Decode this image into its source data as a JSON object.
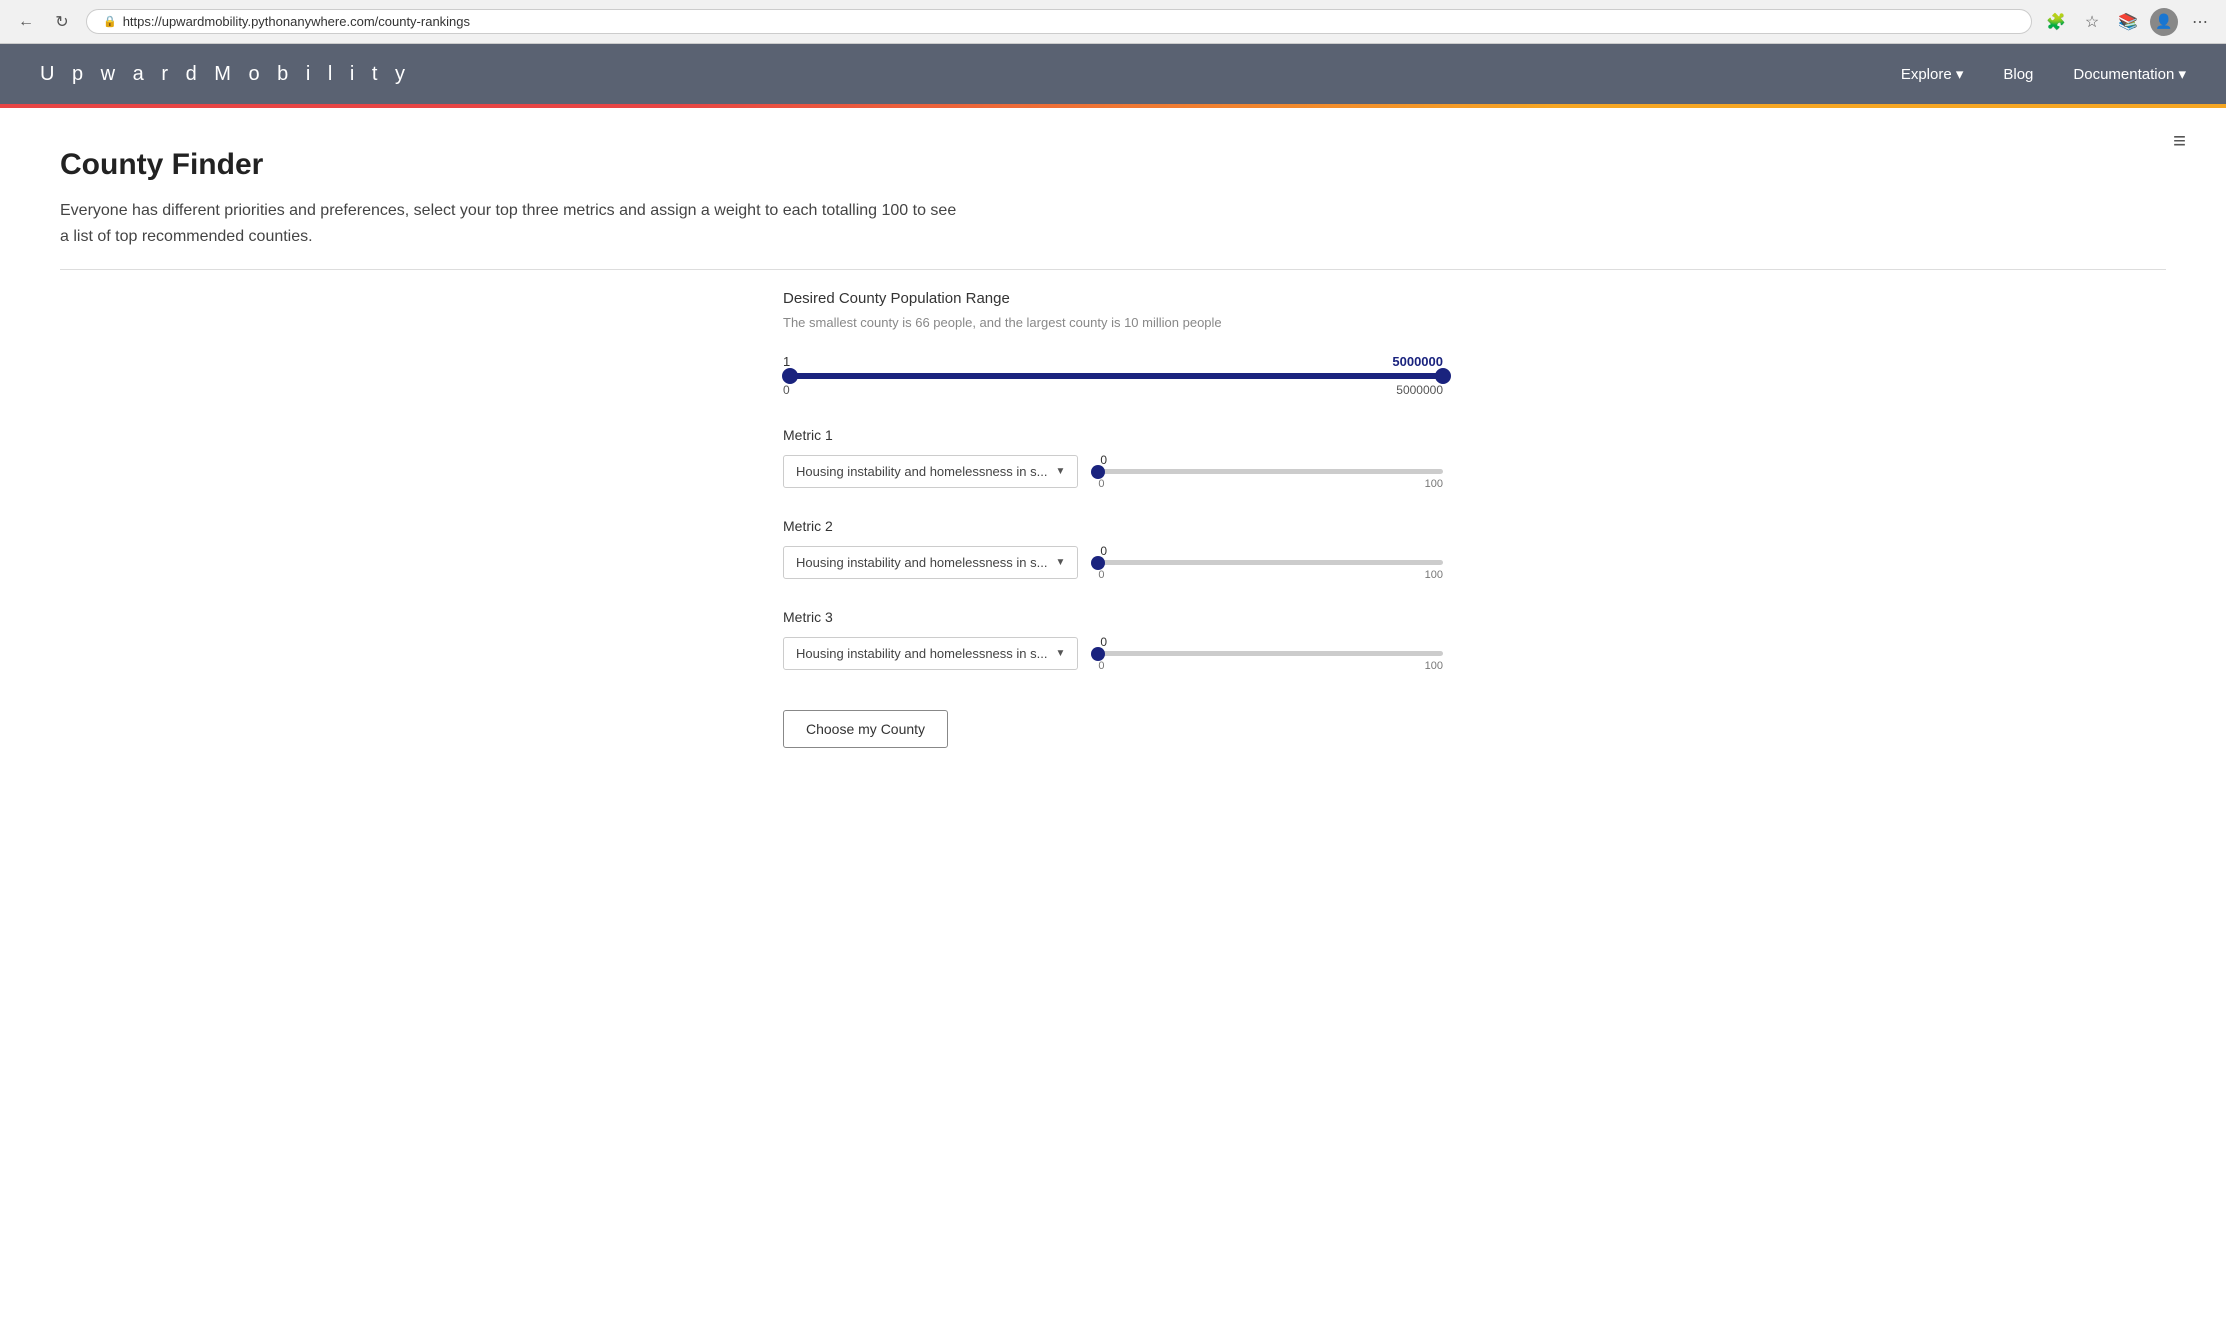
{
  "browser": {
    "url": "https://upwardmobility.pythonanywhere.com/county-rankings",
    "back_label": "←",
    "refresh_label": "↻",
    "menu_label": "⋯"
  },
  "navbar": {
    "brand": "U p w a r d   M o b i l i t y",
    "links": [
      {
        "label": "Explore ▾",
        "key": "explore"
      },
      {
        "label": "Blog",
        "key": "blog"
      },
      {
        "label": "Documentation ▾",
        "key": "documentation"
      }
    ]
  },
  "page": {
    "title": "County Finder",
    "description": "Everyone has different priorities and preferences, select your top three metrics and assign a weight to each totalling 100 to see a list of top recommended counties."
  },
  "population_range": {
    "label": "Desired County Population Range",
    "hint": "The smallest county is 66 people, and the largest county is 10 million people",
    "min_value": "1",
    "max_value": "5000000",
    "min_label": "0",
    "max_label": "5000000",
    "min_pct": 1,
    "max_pct": 100
  },
  "metrics": [
    {
      "label": "Metric 1",
      "dropdown_text": "Housing instability and homelessness in s...",
      "weight_value": "0",
      "weight_min_label": "0",
      "weight_max_label": "100",
      "weight_pct": 0
    },
    {
      "label": "Metric 2",
      "dropdown_text": "Housing instability and homelessness in s...",
      "weight_value": "0",
      "weight_min_label": "0",
      "weight_max_label": "100",
      "weight_pct": 0
    },
    {
      "label": "Metric 3",
      "dropdown_text": "Housing instability and homelessness in s...",
      "weight_value": "0",
      "weight_min_label": "0",
      "weight_max_label": "100",
      "weight_pct": 0
    }
  ],
  "choose_button_label": "Choose my County",
  "menu_icon": "≡"
}
